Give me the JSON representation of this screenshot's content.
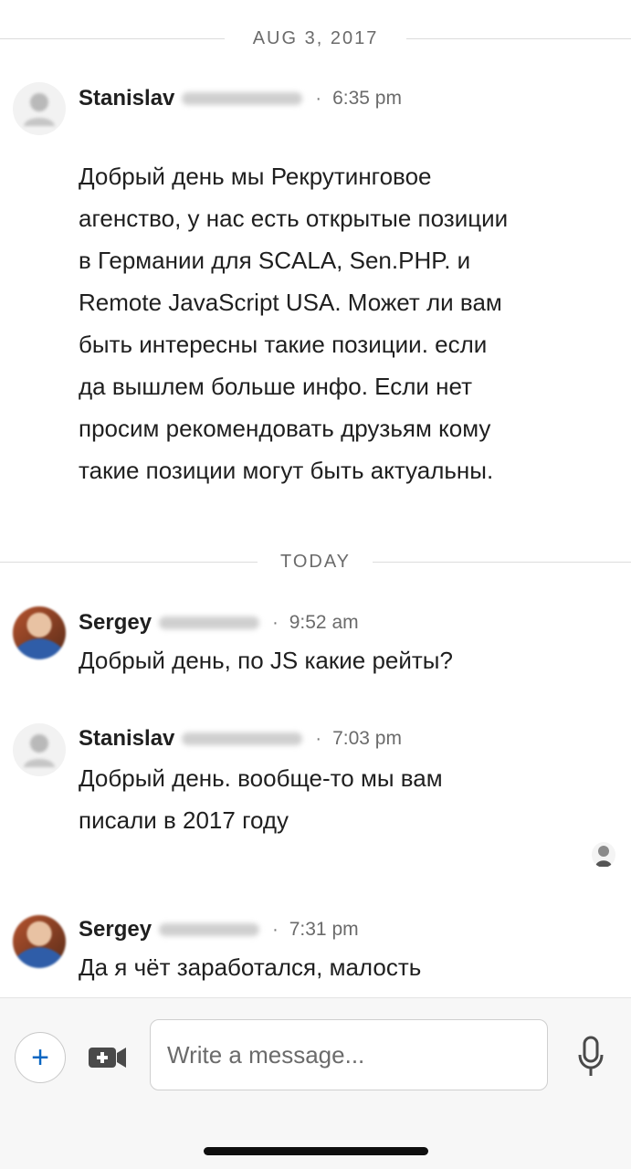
{
  "conversation": {
    "separators": [
      {
        "label": "AUG 3, 2017"
      },
      {
        "label": "TODAY"
      }
    ],
    "messages": [
      {
        "sender": "Stanislav",
        "time": "6:35 pm",
        "text": [
          "Добрый день мы Рекрутинговое",
          "агенство, у нас есть открытые позиции",
          "в Германии для SCALA, Sen.PHP. и",
          "Remote JavaScript USA. Может ли вам",
          "быть интересны такие позиции. если",
          "да вышлем больше инфо. Если нет",
          "просим рекомендовать друзьям кому",
          "такие позиции могут быть актуальны."
        ]
      },
      {
        "sender": "Sergey",
        "time": "9:52 am",
        "text": [
          "Добрый день, по JS какие рейты?"
        ]
      },
      {
        "sender": "Stanislav",
        "time": "7:03 pm",
        "text": [
          "Добрый день. вообще-то мы вам",
          "писали в 2017 году"
        ]
      },
      {
        "sender": "Sergey",
        "time": "7:31 pm",
        "text": [
          "Да я чёт заработался, малость"
        ]
      }
    ],
    "dot": "·"
  },
  "composer": {
    "plus_label": "+",
    "placeholder": "Write a message..."
  },
  "colors": {
    "accent": "#0a66c2",
    "text": "#1f1f1f",
    "muted": "#6b6b6b"
  }
}
